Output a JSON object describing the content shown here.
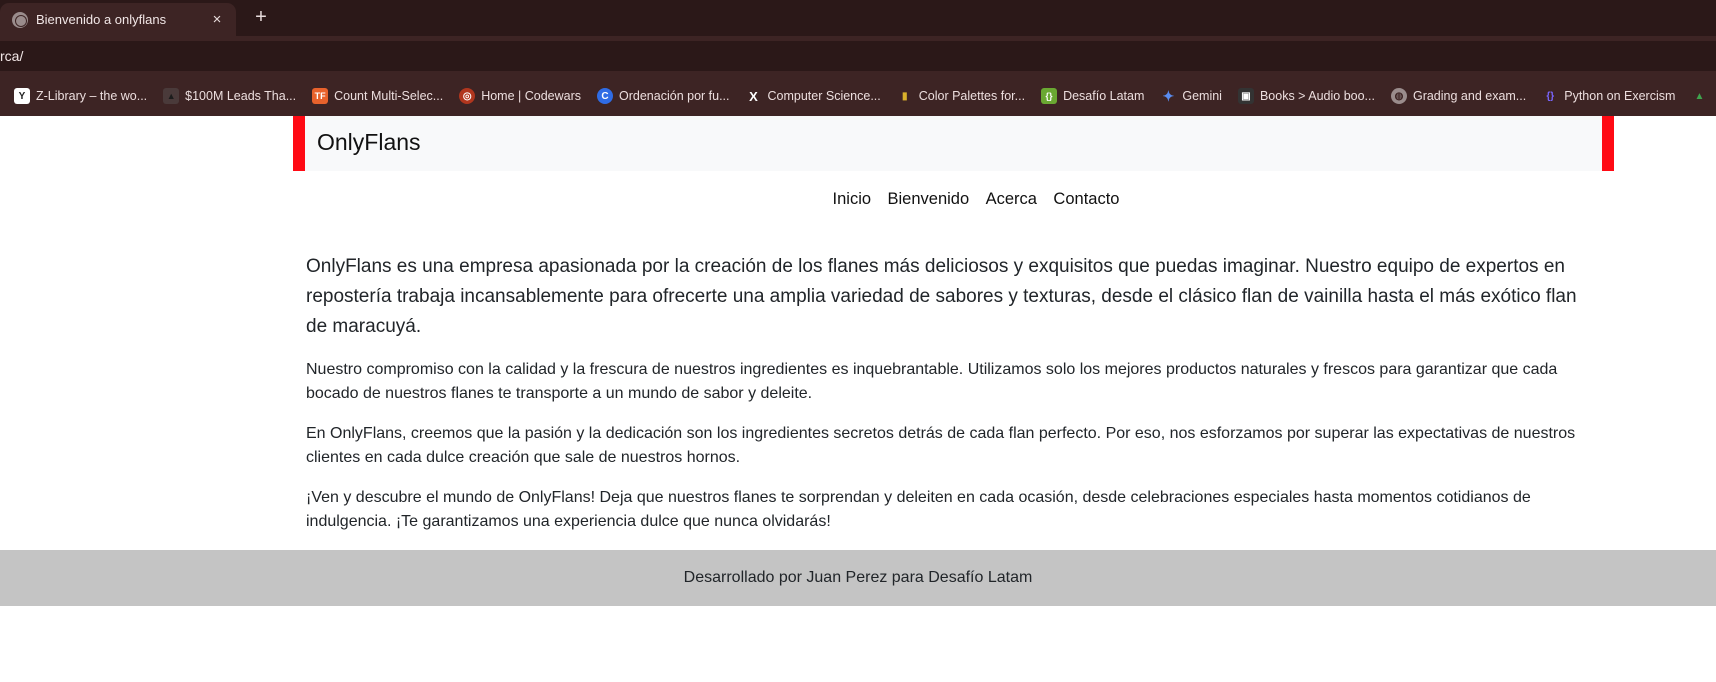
{
  "browser": {
    "tab": {
      "title": "Bienvenido a onlyflans",
      "close": "×"
    },
    "new_tab": "+",
    "address": "rca/",
    "bookmarks": [
      {
        "label": "Z-Library – the wo...",
        "icon": "zlibrary-icon",
        "color": "#ffffff",
        "glyph": "Y"
      },
      {
        "label": "$100M Leads Tha...",
        "icon": "triangle-icon",
        "color": "#4a3a3a",
        "glyph": "▲"
      },
      {
        "label": "Count Multi-Selec...",
        "icon": "tf-icon",
        "color": "#e8622c",
        "glyph": "TF"
      },
      {
        "label": "Home | Codewars",
        "icon": "codewars-icon",
        "color": "#b1361e",
        "glyph": "◎"
      },
      {
        "label": "Ordenación por fu...",
        "icon": "c-icon",
        "color": "#2f6ce5",
        "glyph": "C"
      },
      {
        "label": "Computer Science...",
        "icon": "x-icon",
        "color": "#3d2424",
        "glyph": "X"
      },
      {
        "label": "Color Palettes for...",
        "icon": "palette-icon",
        "color": "#d9b12b",
        "glyph": "▮"
      },
      {
        "label": "Desafío Latam",
        "icon": "desafio-icon",
        "color": "#6aa832",
        "glyph": "{}"
      },
      {
        "label": "Gemini",
        "icon": "gemini-icon",
        "color": "#3d2424",
        "glyph": "✦"
      },
      {
        "label": "Books > Audio boo...",
        "icon": "books-icon",
        "color": "#333333",
        "glyph": "▣"
      },
      {
        "label": "Grading and exam...",
        "icon": "globe-icon",
        "color": "#9a8c8c",
        "glyph": "◍"
      },
      {
        "label": "Python on Exercism",
        "icon": "exercism-icon",
        "color": "#604fcd",
        "glyph": "{}"
      },
      {
        "label": "",
        "icon": "extra-icon",
        "color": "#3fa34d",
        "glyph": "▲"
      }
    ]
  },
  "site": {
    "brand": "OnlyFlans",
    "nav": [
      "Inicio",
      "Bienvenido",
      "Acerca",
      "Contacto"
    ],
    "lead": "OnlyFlans es una empresa apasionada por la creación de los flanes más deliciosos y exquisitos que puedas imaginar. Nuestro equipo de expertos en repostería trabaja incansablemente para ofrecerte una amplia variedad de sabores y texturas, desde el clásico flan de vainilla hasta el más exótico flan de maracuyá.",
    "paragraphs": [
      "Nuestro compromiso con la calidad y la frescura de nuestros ingredientes es inquebrantable. Utilizamos solo los mejores productos naturales y frescos para garantizar que cada bocado de nuestros flanes te transporte a un mundo de sabor y deleite.",
      "En OnlyFlans, creemos que la pasión y la dedicación son los ingredientes secretos detrás de cada flan perfecto. Por eso, nos esforzamos por superar las expectativas de nuestros clientes en cada dulce creación que sale de nuestros hornos.",
      "¡Ven y descubre el mundo de OnlyFlans! Deja que nuestros flanes te sorprendan y deleiten en cada ocasión, desde celebraciones especiales hasta momentos cotidianos de indulgencia. ¡Te garantizamos una experiencia dulce que nunca olvidarás!"
    ],
    "footer": "Desarrollado por Juan Perez para Desafío Latam"
  },
  "colors": {
    "accent": "#ff0a14",
    "navbar_bg": "#f8f9fa",
    "footer_bg": "#c4c4c4",
    "chrome_dark": "#2b1818",
    "chrome_mid": "#3d2424"
  }
}
